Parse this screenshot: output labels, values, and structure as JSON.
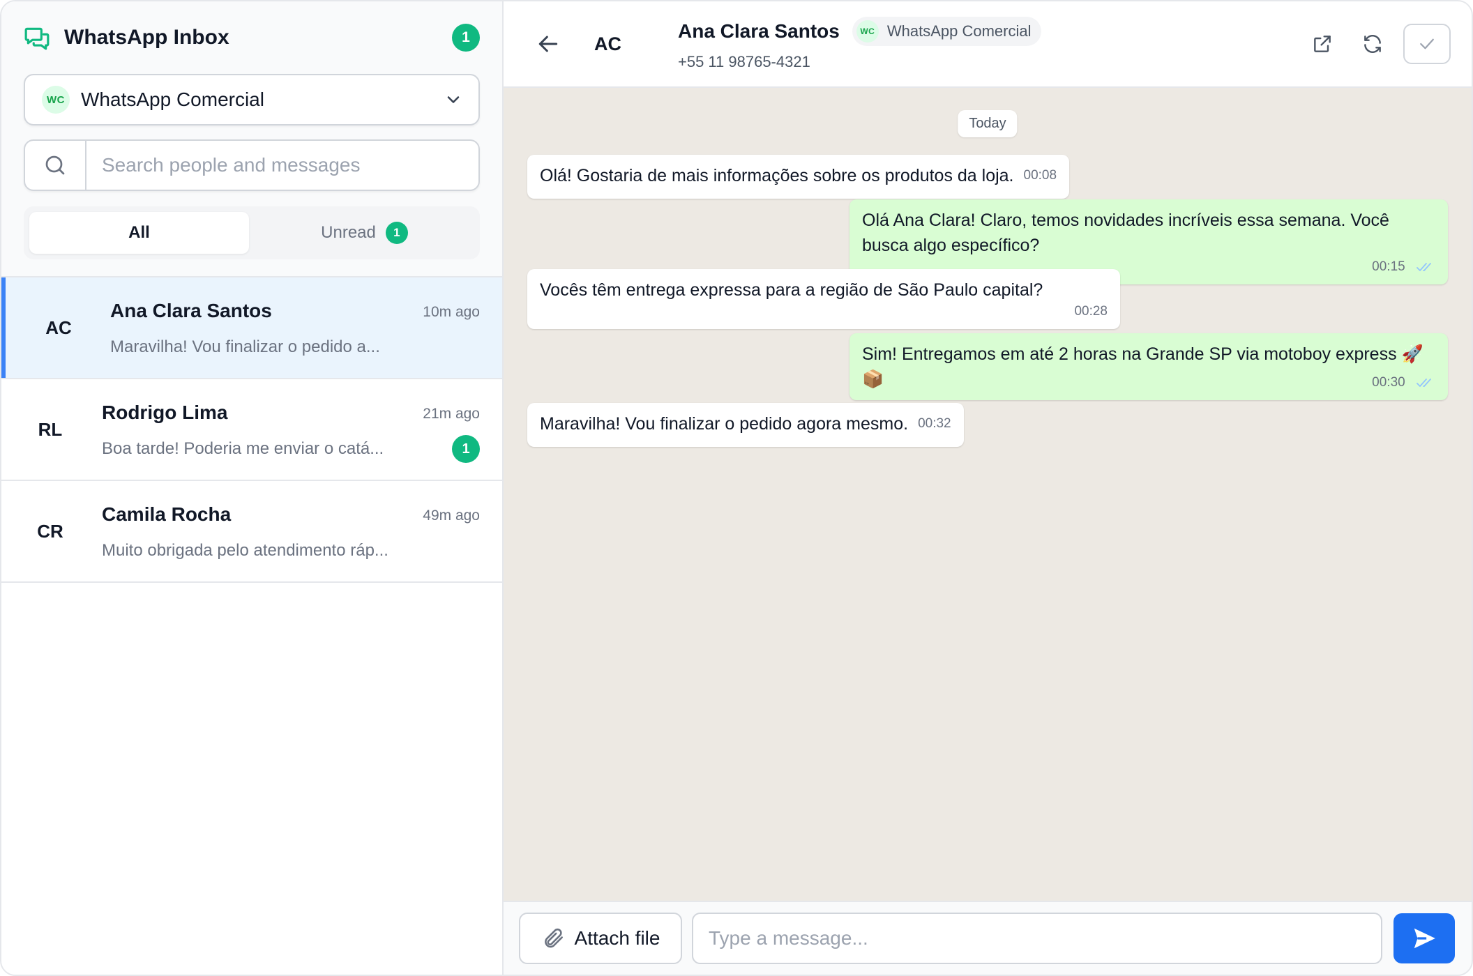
{
  "sidebar": {
    "title": "WhatsApp Inbox",
    "total_unread": "1",
    "account_select": {
      "avatar": "WC",
      "value": "WhatsApp Comercial"
    },
    "search": {
      "placeholder": "Search people and messages"
    },
    "tabs": [
      {
        "label": "All",
        "active": true
      },
      {
        "label": "Unread",
        "badge": "1"
      }
    ],
    "conversations": [
      {
        "initials": "AC",
        "name": "Ana Clara Santos",
        "time": "10m ago",
        "preview": "Maravilha! Vou finalizar o pedido a...",
        "selected": true
      },
      {
        "initials": "RL",
        "name": "Rodrigo Lima",
        "time": "21m ago",
        "preview": "Boa tarde! Poderia me enviar o catá...",
        "unread": "1"
      },
      {
        "initials": "CR",
        "name": "Camila Rocha",
        "time": "49m ago",
        "preview": "Muito obrigada pelo atendimento ráp..."
      }
    ]
  },
  "chat": {
    "header": {
      "initials": "AC",
      "name": "Ana Clara Santos",
      "account_avatar": "WC",
      "account": "WhatsApp Comercial",
      "phone": "+55 11 98765-4321"
    },
    "day_separator": "Today",
    "messages": [
      {
        "direction": "in",
        "text": "Olá! Gostaria de mais informações sobre os produtos da loja.",
        "time": "00:08"
      },
      {
        "direction": "out",
        "text": "Olá Ana Clara! Claro, temos novidades incríveis essa semana. Você busca algo específico?",
        "time": "00:15",
        "status": "read"
      },
      {
        "direction": "in",
        "text": "Vocês têm entrega expressa para a região de São Paulo capital?",
        "time": "00:28"
      },
      {
        "direction": "out",
        "text": "Sim! Entregamos em até 2 horas na Grande SP via motoboy express 🚀📦",
        "time": "00:30",
        "status": "read"
      },
      {
        "direction": "in",
        "text": "Maravilha! Vou finalizar o pedido agora mesmo.",
        "time": "00:32"
      }
    ],
    "composer": {
      "attach_label": "Attach file",
      "placeholder": "Type a message..."
    }
  },
  "icons": {
    "logo": "chat-bubbles-icon",
    "chevron": "chevron-down-icon",
    "search": "search-icon",
    "back": "arrow-left-icon",
    "open_external": "external-link-icon",
    "refresh": "refresh-icon",
    "resolve": "check-icon",
    "attach": "paperclip-icon",
    "send": "send-icon"
  },
  "colors": {
    "accent_green": "#10b981",
    "selected_bar": "#3b82f6",
    "outgoing_bubble": "#d9fdd3",
    "chat_background": "#ede9e3",
    "send_button": "#1d6ff2"
  }
}
